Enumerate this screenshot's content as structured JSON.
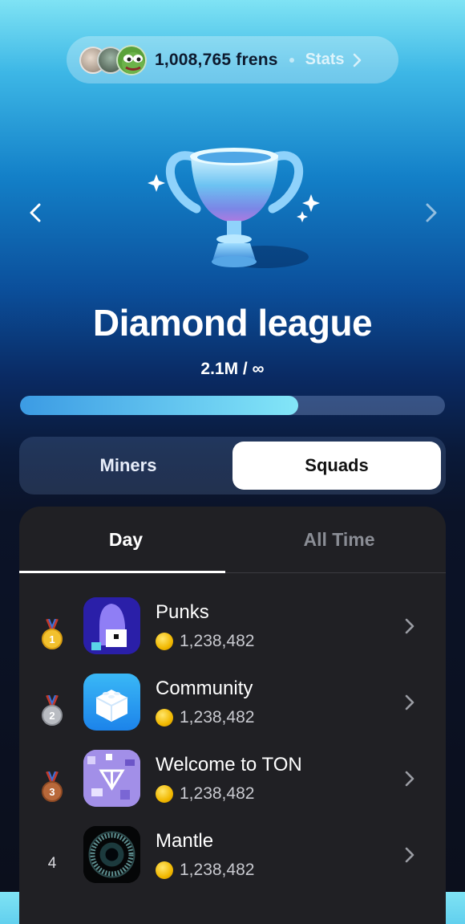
{
  "header": {
    "frens_count": "1,008,765 frens",
    "stats_label": "Stats"
  },
  "league": {
    "title": "Diamond league",
    "progress_text": "2.1M / ∞",
    "progress_fraction": 0.655
  },
  "segments": {
    "miners": "Miners",
    "squads": "Squads",
    "selected": "Squads"
  },
  "tabs": {
    "day": "Day",
    "all_time": "All Time",
    "selected": "Day"
  },
  "squads": [
    {
      "rank": "1",
      "medal": "gold-medal",
      "name": "Punks",
      "score": "1,238,482",
      "icon": "punk-icon"
    },
    {
      "rank": "2",
      "medal": "silver-medal",
      "name": "Community",
      "score": "1,238,482",
      "icon": "blocks-icon"
    },
    {
      "rank": "3",
      "medal": "bronze-medal",
      "name": "Welcome to TON",
      "score": "1,238,482",
      "icon": "ton-icon"
    },
    {
      "rank": "4",
      "medal": "",
      "name": "Mantle",
      "score": "1,238,482",
      "icon": "mantle-icon"
    }
  ],
  "colors": {
    "accent_blue": "#3b9be4",
    "accent_cyan": "#83e6f8",
    "board_bg": "#202024",
    "coin_gold": "#f1b800"
  }
}
